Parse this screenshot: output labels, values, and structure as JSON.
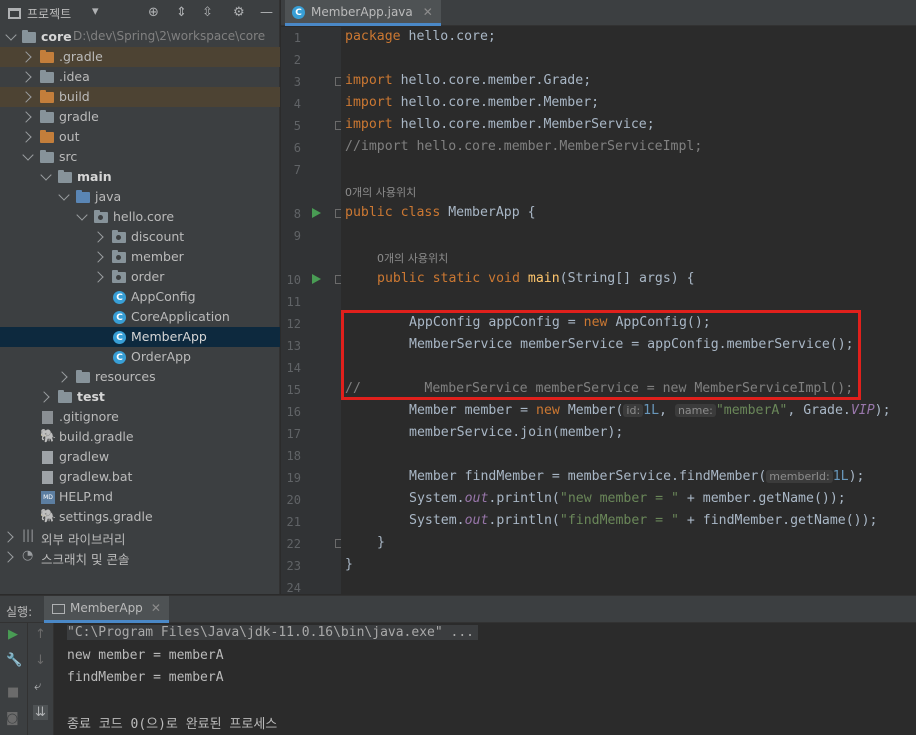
{
  "project_panel": {
    "title": "프로젝트",
    "tree": [
      {
        "label": "core",
        "extra": "D:\\dev\\Spring\\2\\workspace\\core",
        "icon": "folder-icon"
      },
      {
        "label": ".gradle",
        "icon": "folder-icon"
      },
      {
        "label": ".idea",
        "icon": "folder-icon"
      },
      {
        "label": "build",
        "icon": "folder-icon"
      },
      {
        "label": "gradle",
        "icon": "folder-icon"
      },
      {
        "label": "out",
        "icon": "folder-icon"
      },
      {
        "label": "src",
        "icon": "folder-icon"
      },
      {
        "label": "main",
        "icon": "folder-icon"
      },
      {
        "label": "java",
        "icon": "source-folder-icon"
      },
      {
        "label": "hello.core",
        "icon": "package-icon"
      },
      {
        "label": "discount",
        "icon": "package-icon"
      },
      {
        "label": "member",
        "icon": "package-icon"
      },
      {
        "label": "order",
        "icon": "package-icon"
      },
      {
        "label": "AppConfig",
        "icon": "java-class-icon"
      },
      {
        "label": "CoreApplication",
        "icon": "java-class-icon"
      },
      {
        "label": "MemberApp",
        "icon": "java-class-icon"
      },
      {
        "label": "OrderApp",
        "icon": "java-class-icon"
      },
      {
        "label": "resources",
        "icon": "resources-folder-icon"
      },
      {
        "label": "test",
        "icon": "test-folder-icon"
      },
      {
        "label": ".gitignore",
        "icon": "gitignore-file-icon"
      },
      {
        "label": "build.gradle",
        "icon": "gradle-file-icon"
      },
      {
        "label": "gradlew",
        "icon": "file-icon"
      },
      {
        "label": "gradlew.bat",
        "icon": "file-icon"
      },
      {
        "label": "HELP.md",
        "icon": "markdown-file-icon"
      },
      {
        "label": "settings.gradle",
        "icon": "gradle-file-icon"
      },
      {
        "label": "외부 라이브러리",
        "icon": "library-icon"
      },
      {
        "label": "스크래치 및 콘솔",
        "icon": "scratch-icon"
      }
    ]
  },
  "editor": {
    "tab_label": "MemberApp.java",
    "usage_hint_class": "0개의 사용위치",
    "usage_hint_main": "0개의 사용위치",
    "line_numbers": [
      "1",
      "2",
      "3",
      "4",
      "5",
      "6",
      "7",
      "8",
      "9",
      "10",
      "11",
      "12",
      "13",
      "14",
      "15",
      "16",
      "17",
      "18",
      "19",
      "20",
      "21",
      "22",
      "23",
      "24"
    ],
    "code": {
      "l1_kw": "package",
      "l1_rest": " hello.core;",
      "l3_kw": "import",
      "l3_rest": " hello.core.member.Grade;",
      "l4_kw": "import",
      "l4_rest": " hello.core.member.Member;",
      "l5_kw": "import",
      "l5_rest": " hello.core.member.MemberService;",
      "l6": "//import hello.core.member.MemberServiceImpl;",
      "l8_kw": "public class",
      "l8_rest": " MemberApp {",
      "l10_kw": "public static void",
      "l10_fn": "main",
      "l10_rest": "(String[] args) {",
      "l12_a": "AppConfig appConfig = ",
      "l12_kw": "new",
      "l12_b": " AppConfig();",
      "l13": "MemberService memberService = appConfig.memberService();",
      "l15_cm": "//        MemberService memberService = new MemberServiceImpl();",
      "l16_a": "Member member = ",
      "l16_kw": "new",
      "l16_b": " Member(",
      "l16_hint1": "id:",
      "l16_num": "1L",
      "l16_c": ", ",
      "l16_hint2": "name:",
      "l16_str": "\"memberA\"",
      "l16_d": ", Grade.",
      "l16_fld": "VIP",
      "l16_e": ");",
      "l17": "memberService.join(member);",
      "l19_a": "Member findMember = memberService.findMember(",
      "l19_hint": "memberId:",
      "l19_num": "1L",
      "l19_b": ");",
      "l20_a": "System.",
      "l20_fld": "out",
      "l20_b": ".println(",
      "l20_str": "\"new member = \"",
      "l20_c": " + member.getName());",
      "l21_a": "System.",
      "l21_fld": "out",
      "l21_b": ".println(",
      "l21_str": "\"findMember = \"",
      "l21_c": " + findMember.getName());",
      "l22": "}",
      "l23": "}"
    }
  },
  "run_panel": {
    "label": "실행:",
    "tab_label": "MemberApp",
    "console_lines": [
      "\"C:\\Program Files\\Java\\jdk-11.0.16\\bin\\java.exe\" ...",
      "new member = memberA",
      "findMember = memberA",
      "",
      "종료 코드 0(으)로 완료된 프로세스"
    ]
  }
}
